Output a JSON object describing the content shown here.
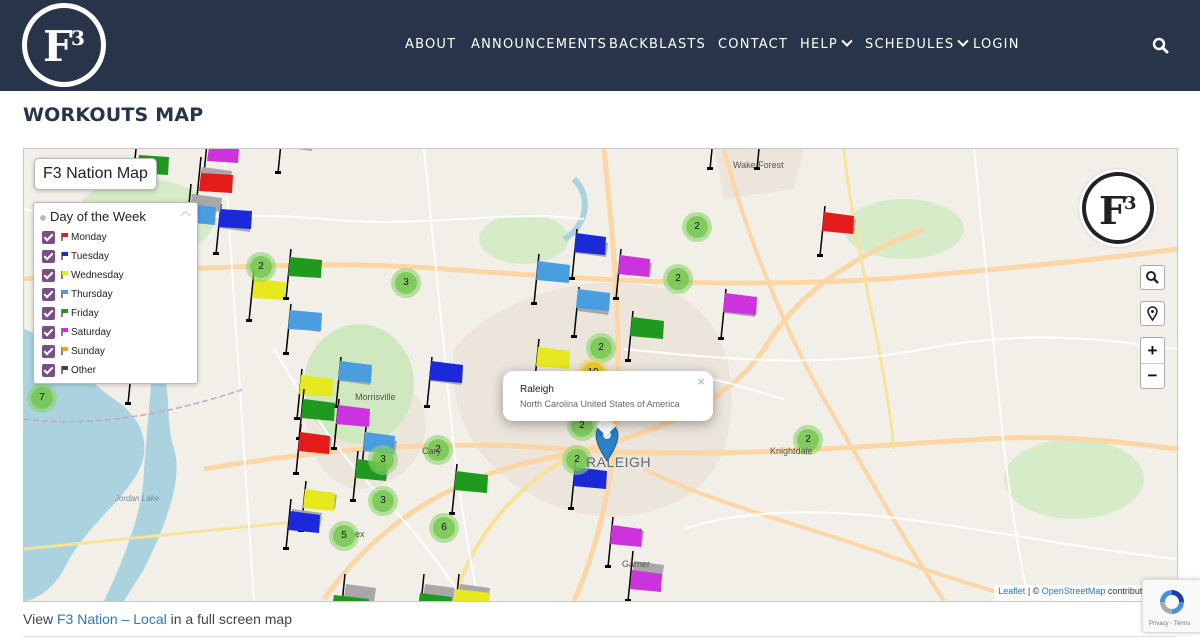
{
  "nav": {
    "items": [
      {
        "label": "ABOUT",
        "dropdown": false
      },
      {
        "label": "ANNOUNCEMENTS",
        "dropdown": false
      },
      {
        "label": "BACKBLASTS",
        "dropdown": false
      },
      {
        "label": "CONTACT",
        "dropdown": false
      },
      {
        "label": "HELP",
        "dropdown": true
      },
      {
        "label": "SCHEDULES",
        "dropdown": true
      },
      {
        "label": "LOGIN",
        "dropdown": false
      }
    ],
    "search_icon": "search-icon"
  },
  "page": {
    "title": "WORKOUTS MAP"
  },
  "map": {
    "title": "F3 Nation Map",
    "legend": {
      "heading": "Day of the Week",
      "items": [
        {
          "label": "Monday",
          "color": "#e31b1b",
          "checked": true
        },
        {
          "label": "Tuesday",
          "color": "#1b2ad9",
          "checked": true
        },
        {
          "label": "Wednesday",
          "color": "#e8e81e",
          "checked": true
        },
        {
          "label": "Thursday",
          "color": "#4a9ee0",
          "checked": true
        },
        {
          "label": "Friday",
          "color": "#1f9a1f",
          "checked": true
        },
        {
          "label": "Saturday",
          "color": "#cc33dd",
          "checked": true
        },
        {
          "label": "Sunday",
          "color": "#f0a020",
          "checked": true
        },
        {
          "label": "Other",
          "color": "#444444",
          "checked": true
        }
      ]
    },
    "popup": {
      "title": "Raleigh",
      "subtitle": "North Carolina United States of America",
      "close": "×"
    },
    "labels": {
      "raleigh": "RALEIGH",
      "morrisville": "Morrisville",
      "knightdale": "Knightdale",
      "garner": "Garner",
      "wake_forest": "Wake Forest",
      "jordan_lake": "Jordan Lake",
      "cary_fragment": "Cary",
      "apex_fragment": "ex"
    },
    "clusters": [
      "2",
      "2",
      "3",
      "2",
      "2",
      "7",
      "2",
      "2",
      "2",
      "3",
      "3",
      "6",
      "5",
      "2",
      "10"
    ],
    "controls": {
      "zoom_in": "+",
      "zoom_out": "−"
    },
    "attribution": {
      "leaflet": "Leaflet",
      "separator": " | © ",
      "osm": "OpenStreetMap",
      "suffix": " contributors © C"
    },
    "flag_colors": {
      "monday": "#e31b1b",
      "tuesday": "#1b2ad9",
      "wednesday": "#e8e81e",
      "thursday": "#4a9ee0",
      "friday": "#1f9a1f",
      "saturday": "#cc33dd",
      "shadow": "#a8a8a8"
    }
  },
  "footer": {
    "prefix": "View ",
    "link": "F3 Nation – Local",
    "suffix": " in a full screen map"
  },
  "recaptcha": {
    "text": "Privacy - Terms"
  }
}
